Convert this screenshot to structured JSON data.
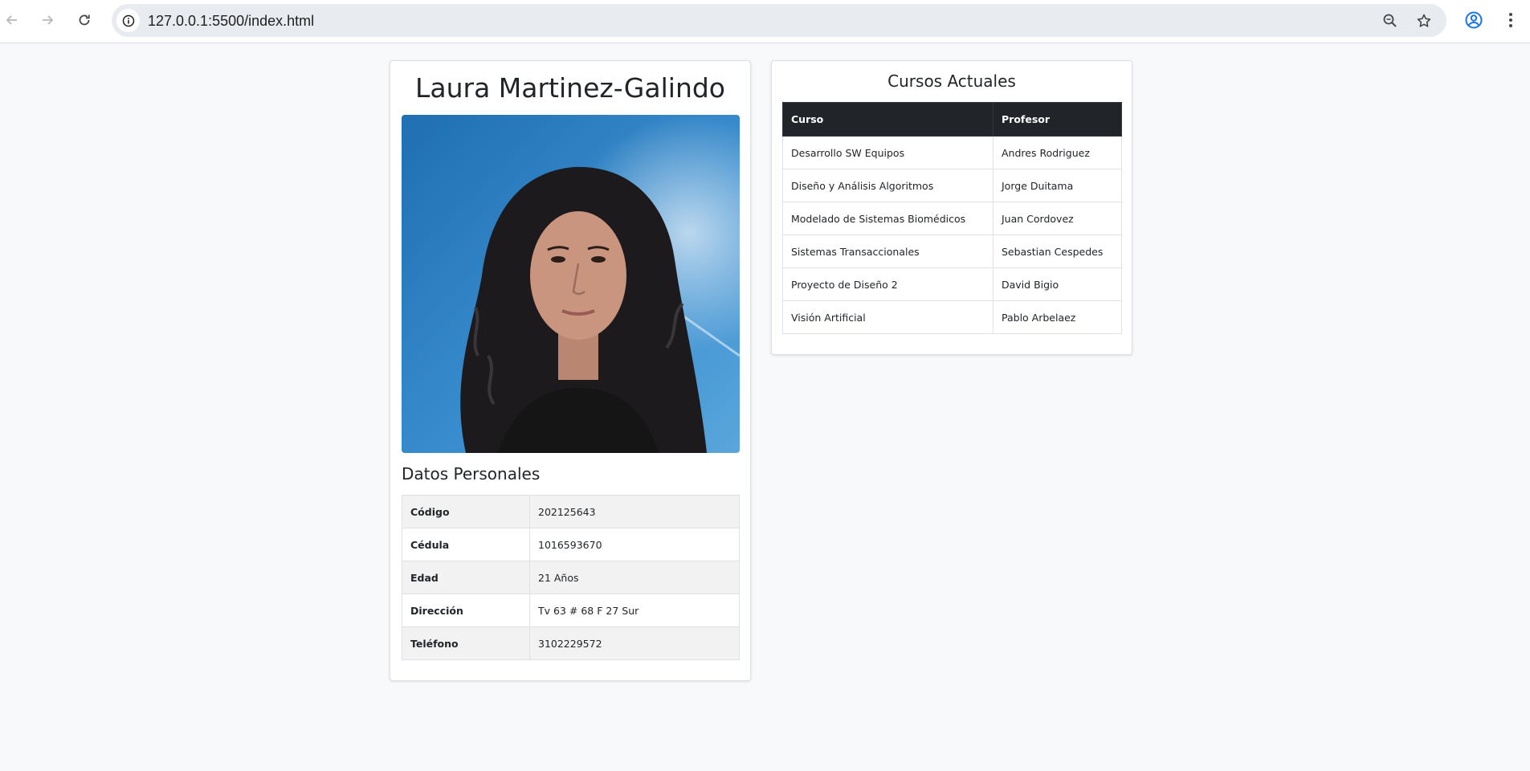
{
  "browser": {
    "url": "127.0.0.1:5500/index.html",
    "icons": [
      "back-arrow-icon",
      "forward-arrow-icon",
      "reload-icon",
      "site-info-icon",
      "zoom-icon",
      "bookmark-star-icon",
      "profile-icon",
      "menu-dots-icon"
    ]
  },
  "profile": {
    "name": "Laura Martinez-Galindo",
    "photo_alt": "Foto de perfil",
    "section_title": "Datos Personales",
    "fields": [
      {
        "label": "Código",
        "value": "202125643"
      },
      {
        "label": "Cédula",
        "value": "1016593670"
      },
      {
        "label": "Edad",
        "value": "21 Años"
      },
      {
        "label": "Dirección",
        "value": "Tv 63 # 68 F 27 Sur"
      },
      {
        "label": "Teléfono",
        "value": "3102229572"
      }
    ]
  },
  "courses": {
    "title": "Cursos Actuales",
    "headers": [
      "Curso",
      "Profesor"
    ],
    "rows": [
      {
        "course": "Desarrollo SW Equipos",
        "teacher": "Andres Rodriguez"
      },
      {
        "course": "Diseño y Análisis Algoritmos",
        "teacher": "Jorge Duitama"
      },
      {
        "course": "Modelado de Sistemas Biomédicos",
        "teacher": "Juan Cordovez"
      },
      {
        "course": "Sistemas Transaccionales",
        "teacher": "Sebastian Cespedes"
      },
      {
        "course": "Proyecto de Diseño 2",
        "teacher": "David Bigio"
      },
      {
        "course": "Visión Artificial",
        "teacher": "Pablo Arbelaez"
      }
    ]
  },
  "colors": {
    "page_bg": "#f8f9fa",
    "table_header_bg": "#212529",
    "striped_row_bg": "#f2f2f2",
    "omnibox_bg": "#e8ebf0",
    "profile_icon_color": "#1a73e8"
  }
}
